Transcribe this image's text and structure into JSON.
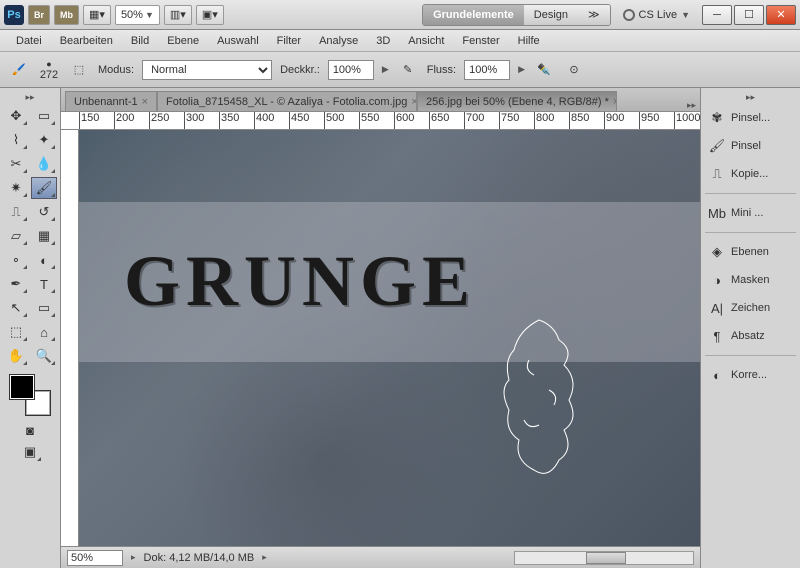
{
  "titlebar": {
    "zoom": "50%",
    "workspaces": {
      "active": "Grundelemente",
      "other": "Design"
    },
    "cslive": "CS Live"
  },
  "menu": [
    "Datei",
    "Bearbeiten",
    "Bild",
    "Ebene",
    "Auswahl",
    "Filter",
    "Analyse",
    "3D",
    "Ansicht",
    "Fenster",
    "Hilfe"
  ],
  "options": {
    "brush_size": "272",
    "modus_label": "Modus:",
    "modus_value": "Normal",
    "deckk_label": "Deckkr.:",
    "deckk_value": "100%",
    "fluss_label": "Fluss:",
    "fluss_value": "100%"
  },
  "tabs": [
    {
      "label": "Unbenannt-1",
      "active": false
    },
    {
      "label": "Fotolia_8715458_XL - © Azaliya - Fotolia.com.jpg",
      "active": false
    },
    {
      "label": "256.jpg bei 50% (Ebene 4, RGB/8#) *",
      "active": true
    }
  ],
  "ruler_ticks": [
    "150",
    "200",
    "250",
    "300",
    "350",
    "400",
    "450",
    "500",
    "550",
    "600",
    "650",
    "700",
    "750",
    "800",
    "850",
    "900",
    "950",
    "1000"
  ],
  "canvas_text": "GRUNGE",
  "status": {
    "zoom": "50%",
    "doc": "Dok: 4,12 MB/14,0 MB"
  },
  "panels": [
    {
      "icon": "brushpresets",
      "label": "Pinsel..."
    },
    {
      "icon": "brush",
      "label": "Pinsel"
    },
    {
      "icon": "clone",
      "label": "Kopie..."
    },
    {
      "sep": true
    },
    {
      "icon": "mb",
      "label": "Mini ..."
    },
    {
      "sep": true
    },
    {
      "icon": "layers",
      "label": "Ebenen"
    },
    {
      "icon": "masks",
      "label": "Masken"
    },
    {
      "icon": "char",
      "label": "Zeichen"
    },
    {
      "icon": "para",
      "label": "Absatz"
    },
    {
      "sep": true
    },
    {
      "icon": "adjust",
      "label": "Korre..."
    }
  ]
}
